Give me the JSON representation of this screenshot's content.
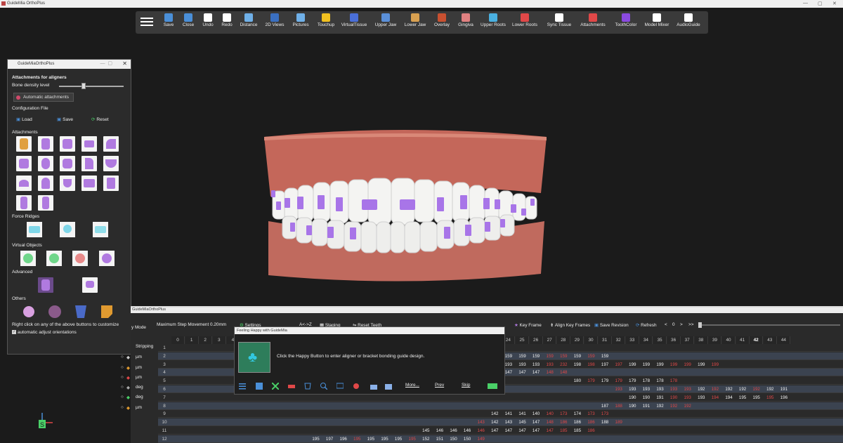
{
  "app": {
    "title": "GuideMia OrthoPlus"
  },
  "toolbar": [
    {
      "label": "Save",
      "icon": "save-icon",
      "color": "#4a8fd8"
    },
    {
      "label": "Close",
      "icon": "close-file-icon",
      "color": "#4a8fd8"
    },
    {
      "label": "Undo",
      "icon": "undo-icon",
      "color": "#ffffff"
    },
    {
      "label": "Redo",
      "icon": "redo-icon",
      "color": "#ffffff"
    },
    {
      "label": "Distance",
      "icon": "ruler-icon",
      "color": "#6fb0e8"
    },
    {
      "label": "2D Views",
      "icon": "views-icon",
      "color": "#3a6fc0"
    },
    {
      "label": "Pictures",
      "icon": "pictures-icon",
      "color": "#6fb0e8"
    },
    {
      "label": "Touchup",
      "icon": "touchup-icon",
      "color": "#f0c020"
    },
    {
      "label": "VirtualTissue",
      "icon": "tissue-icon",
      "color": "#4a6fd8"
    },
    {
      "label": "Upper Jaw",
      "icon": "upper-jaw-icon",
      "color": "#5a8fd8"
    },
    {
      "label": "Lower Jaw",
      "icon": "lower-jaw-icon",
      "color": "#d8a050"
    },
    {
      "label": "Overlay",
      "icon": "overlay-icon",
      "color": "#c85030"
    },
    {
      "label": "Gingiva",
      "icon": "gingiva-icon",
      "color": "#e08080"
    },
    {
      "label": "Upper Roots",
      "icon": "upper-roots-icon",
      "color": "#4ab0e0"
    },
    {
      "label": "Lower Roots",
      "icon": "lower-roots-icon",
      "color": "#e04848"
    },
    {
      "label": "Sync Tissue",
      "icon": "sync-tissue-icon",
      "color": "#ffffff"
    },
    {
      "label": "Attachments",
      "icon": "attachments-icon",
      "color": "#e04848"
    },
    {
      "label": "ToothColor",
      "icon": "tooth-color-icon",
      "color": "#8a4ae0"
    },
    {
      "label": "Model Mixer",
      "icon": "cube-icon",
      "color": "#ffffff"
    },
    {
      "label": "AudioGuide",
      "icon": "microphone-off-icon",
      "color": "#ffffff"
    }
  ],
  "panel": {
    "title": "GuideMiaOrthoPlus",
    "heading": "Attachments for aligners",
    "bone_label": "Bone density level",
    "bone_level": 0.6,
    "auto_btn": "Automatic attachments",
    "config_label": "Configuration File",
    "load": "Load",
    "save": "Save",
    "reset": "Reset",
    "attachments_label": "Attachments",
    "force_label": "Force Ridges",
    "virtual_label": "Virtual Objects",
    "advanced_label": "Advanced",
    "others_label": "Others",
    "hint": "Right click on any of the above buttons to customize",
    "auto_orient": "automatic adjust orientations"
  },
  "bottom": {
    "title": "GuideMiaOrthoPlus",
    "mode": "y Mode",
    "stripping": "Stripping",
    "max_step": "Maximum Step Movement",
    "max_step_val": "0.20mm",
    "settings": "Settings",
    "az": "A<->Z",
    "staging": "Staging",
    "reset_teeth": "Reset Teeth",
    "key_frame": "Key Frame",
    "align_key": "Align Key Frames",
    "save_revision": "Save Revision",
    "refresh": "Refresh",
    "nav_prev": "<",
    "nav_val": "0",
    "nav_next": ">",
    "nav_last": ">>",
    "units": [
      "µm",
      "µm",
      "µm",
      "deg",
      "deg",
      "µm"
    ]
  },
  "grid": {
    "cols": [
      "0",
      "1",
      "2",
      "3",
      "4",
      "5",
      "6",
      "7",
      "8",
      "9",
      "10",
      "11",
      "12",
      "13",
      "14",
      "15",
      "16",
      "17",
      "18",
      "19",
      "20",
      "21",
      "22",
      "23",
      "24",
      "25",
      "26",
      "27",
      "28",
      "29",
      "30",
      "31",
      "32",
      "33",
      "34",
      "35",
      "36",
      "37",
      "38",
      "39",
      "40",
      "41",
      "42",
      "43",
      "44"
    ],
    "rows": [
      {
        "n": "1",
        "cells": []
      },
      {
        "n": "2",
        "cells": [
          {
            "c": 23,
            "v": "159",
            "r": true
          },
          {
            "c": 24,
            "v": "159"
          },
          {
            "c": 25,
            "v": "159"
          },
          {
            "c": 26,
            "v": "159"
          },
          {
            "c": 27,
            "v": "159",
            "r": true
          },
          {
            "c": 28,
            "v": "159",
            "r": true
          },
          {
            "c": 29,
            "v": "159"
          },
          {
            "c": 30,
            "v": "159",
            "r": true
          },
          {
            "c": 31,
            "v": "159"
          }
        ]
      },
      {
        "n": "3",
        "cells": [
          {
            "c": 23,
            "v": "193"
          },
          {
            "c": 24,
            "v": "193"
          },
          {
            "c": 25,
            "v": "193"
          },
          {
            "c": 26,
            "v": "193"
          },
          {
            "c": 27,
            "v": "193",
            "r": true
          },
          {
            "c": 28,
            "v": "232",
            "r": true
          },
          {
            "c": 29,
            "v": "198"
          },
          {
            "c": 30,
            "v": "198",
            "r": true
          },
          {
            "c": 31,
            "v": "197"
          },
          {
            "c": 32,
            "v": "197",
            "r": true
          },
          {
            "c": 33,
            "v": "199"
          },
          {
            "c": 34,
            "v": "199"
          },
          {
            "c": 35,
            "v": "199"
          },
          {
            "c": 36,
            "v": "199",
            "r": true
          },
          {
            "c": 37,
            "v": "199",
            "r": true
          },
          {
            "c": 38,
            "v": "199"
          },
          {
            "c": 39,
            "v": "199",
            "r": true
          }
        ]
      },
      {
        "n": "4",
        "cells": [
          {
            "c": 23,
            "v": "148"
          },
          {
            "c": 24,
            "v": "147"
          },
          {
            "c": 25,
            "v": "147"
          },
          {
            "c": 26,
            "v": "147"
          },
          {
            "c": 27,
            "v": "148",
            "r": true
          },
          {
            "c": 28,
            "v": "148",
            "r": true
          }
        ]
      },
      {
        "n": "5",
        "cells": [
          {
            "c": 29,
            "v": "180"
          },
          {
            "c": 30,
            "v": "179",
            "r": true
          },
          {
            "c": 31,
            "v": "179"
          },
          {
            "c": 32,
            "v": "179",
            "r": true
          },
          {
            "c": 33,
            "v": "179"
          },
          {
            "c": 34,
            "v": "178"
          },
          {
            "c": 35,
            "v": "178"
          },
          {
            "c": 36,
            "v": "178",
            "r": true
          }
        ]
      },
      {
        "n": "6",
        "cells": [
          {
            "c": 32,
            "v": "193",
            "r": true
          },
          {
            "c": 33,
            "v": "193"
          },
          {
            "c": 34,
            "v": "193"
          },
          {
            "c": 35,
            "v": "193"
          },
          {
            "c": 36,
            "v": "193",
            "r": true
          },
          {
            "c": 37,
            "v": "193",
            "r": true
          },
          {
            "c": 38,
            "v": "192"
          },
          {
            "c": 39,
            "v": "192",
            "r": true
          },
          {
            "c": 40,
            "v": "192"
          },
          {
            "c": 41,
            "v": "192"
          },
          {
            "c": 42,
            "v": "192",
            "r": true
          },
          {
            "c": 43,
            "v": "192"
          },
          {
            "c": 44,
            "v": "191"
          }
        ]
      },
      {
        "n": "7",
        "cells": [
          {
            "c": 33,
            "v": "190"
          },
          {
            "c": 34,
            "v": "190"
          },
          {
            "c": 35,
            "v": "191"
          },
          {
            "c": 36,
            "v": "190",
            "r": true
          },
          {
            "c": 37,
            "v": "193",
            "r": true
          },
          {
            "c": 38,
            "v": "193"
          },
          {
            "c": 39,
            "v": "194",
            "r": true
          },
          {
            "c": 40,
            "v": "194"
          },
          {
            "c": 41,
            "v": "195"
          },
          {
            "c": 42,
            "v": "195"
          },
          {
            "c": 43,
            "v": "195",
            "r": true
          },
          {
            "c": 44,
            "v": "196"
          }
        ]
      },
      {
        "n": "8",
        "cells": [
          {
            "c": 31,
            "v": "187"
          },
          {
            "c": 32,
            "v": "188",
            "r": true
          },
          {
            "c": 33,
            "v": "190"
          },
          {
            "c": 34,
            "v": "191"
          },
          {
            "c": 35,
            "v": "192"
          },
          {
            "c": 36,
            "v": "192",
            "r": true
          },
          {
            "c": 37,
            "v": "192",
            "r": true
          }
        ]
      },
      {
        "n": "9",
        "cells": [
          {
            "c": 23,
            "v": "142"
          },
          {
            "c": 24,
            "v": "141"
          },
          {
            "c": 25,
            "v": "141"
          },
          {
            "c": 26,
            "v": "140"
          },
          {
            "c": 27,
            "v": "140",
            "r": true
          },
          {
            "c": 28,
            "v": "173",
            "r": true
          },
          {
            "c": 29,
            "v": "174"
          },
          {
            "c": 30,
            "v": "173",
            "r": true
          },
          {
            "c": 31,
            "v": "173",
            "r": true
          }
        ]
      },
      {
        "n": "10",
        "cells": [
          {
            "c": 22,
            "v": "143",
            "r": true
          },
          {
            "c": 23,
            "v": "142"
          },
          {
            "c": 24,
            "v": "143"
          },
          {
            "c": 25,
            "v": "145"
          },
          {
            "c": 26,
            "v": "147"
          },
          {
            "c": 27,
            "v": "148",
            "r": true
          },
          {
            "c": 28,
            "v": "186",
            "r": true
          },
          {
            "c": 29,
            "v": "186"
          },
          {
            "c": 30,
            "v": "186",
            "r": true
          },
          {
            "c": 31,
            "v": "188"
          },
          {
            "c": 32,
            "v": "189",
            "r": true
          }
        ]
      },
      {
        "n": "11",
        "cells": [
          {
            "c": 18,
            "v": "145"
          },
          {
            "c": 19,
            "v": "146"
          },
          {
            "c": 20,
            "v": "146"
          },
          {
            "c": 21,
            "v": "146"
          },
          {
            "c": 22,
            "v": "146",
            "r": true
          },
          {
            "c": 23,
            "v": "147"
          },
          {
            "c": 24,
            "v": "147"
          },
          {
            "c": 25,
            "v": "147"
          },
          {
            "c": 26,
            "v": "147"
          },
          {
            "c": 27,
            "v": "147",
            "r": true
          },
          {
            "c": 28,
            "v": "185",
            "r": true
          },
          {
            "c": 29,
            "v": "185"
          },
          {
            "c": 30,
            "v": "186",
            "r": true
          }
        ]
      },
      {
        "n": "12",
        "cells": [
          {
            "c": 10,
            "v": "195"
          },
          {
            "c": 11,
            "v": "197"
          },
          {
            "c": 12,
            "v": "196"
          },
          {
            "c": 13,
            "v": "195",
            "r": true
          },
          {
            "c": 14,
            "v": "195"
          },
          {
            "c": 15,
            "v": "195"
          },
          {
            "c": 16,
            "v": "195"
          },
          {
            "c": 17,
            "v": "195",
            "r": true
          },
          {
            "c": 18,
            "v": "152"
          },
          {
            "c": 19,
            "v": "151"
          },
          {
            "c": 20,
            "v": "150"
          },
          {
            "c": 21,
            "v": "150"
          },
          {
            "c": 22,
            "v": "149",
            "r": true
          }
        ]
      }
    ]
  },
  "popup": {
    "title": "Feeling Happy with GuideMia",
    "message": "Click the Happy Button to enter aligner or bracket bonding guide design.",
    "more": "More...",
    "prev": "Prev",
    "skip": "Skip"
  }
}
